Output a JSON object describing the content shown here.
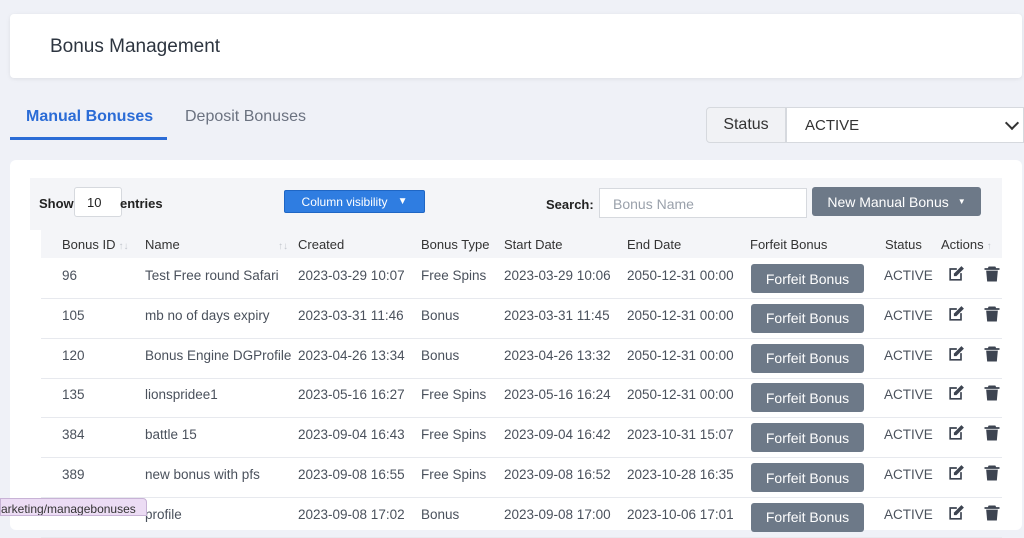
{
  "page": {
    "title": "Bonus Management"
  },
  "tabs": [
    {
      "label": "Manual Bonuses",
      "active": true
    },
    {
      "label": "Deposit Bonuses",
      "active": false
    }
  ],
  "status_filter": {
    "label": "Status",
    "value": "ACTIVE"
  },
  "table_controls": {
    "show_label": "Show",
    "page_length": "10",
    "entries_label": "entries",
    "column_visibility": "Column visibility",
    "search_label": "Search:",
    "search_placeholder": "Bonus Name",
    "new_button": "New Manual Bonus"
  },
  "columns": [
    "Bonus ID",
    "Name",
    "Created",
    "Bonus Type",
    "Start Date",
    "End Date",
    "Forfeit Bonus",
    "Status",
    "Actions"
  ],
  "rows": [
    {
      "id": "96",
      "name": "Test Free round Safari",
      "created": "2023-03-29 10:07",
      "type": "Free Spins",
      "start": "2023-03-29 10:06",
      "end": "2050-12-31 00:00",
      "forfeit": "Forfeit Bonus",
      "status": "ACTIVE"
    },
    {
      "id": "105",
      "name": "mb no of days expiry",
      "created": "2023-03-31 11:46",
      "type": "Bonus",
      "start": "2023-03-31 11:45",
      "end": "2050-12-31 00:00",
      "forfeit": "Forfeit Bonus",
      "status": "ACTIVE"
    },
    {
      "id": "120",
      "name": "Bonus Engine DGProfile",
      "created": "2023-04-26 13:34",
      "type": "Bonus",
      "start": "2023-04-26 13:32",
      "end": "2050-12-31 00:00",
      "forfeit": "Forfeit Bonus",
      "status": "ACTIVE"
    },
    {
      "id": "135",
      "name": "lionspridee1",
      "created": "2023-05-16 16:27",
      "type": "Free Spins",
      "start": "2023-05-16 16:24",
      "end": "2050-12-31 00:00",
      "forfeit": "Forfeit Bonus",
      "status": "ACTIVE"
    },
    {
      "id": "384",
      "name": "battle 15",
      "created": "2023-09-04 16:43",
      "type": "Free Spins",
      "start": "2023-09-04 16:42",
      "end": "2023-10-31 15:07",
      "forfeit": "Forfeit Bonus",
      "status": "ACTIVE"
    },
    {
      "id": "389",
      "name": "new bonus with pfs",
      "created": "2023-09-08 16:55",
      "type": "Free Spins",
      "start": "2023-09-08 16:52",
      "end": "2023-10-28 16:35",
      "forfeit": "Forfeit Bonus",
      "status": "ACTIVE"
    },
    {
      "id": "",
      "name": "profile",
      "created": "2023-09-08 17:02",
      "type": "Bonus",
      "start": "2023-09-08 17:00",
      "end": "2023-10-06 17:01",
      "forfeit": "Forfeit Bonus",
      "status": "ACTIVE"
    }
  ],
  "status_bar": {
    "url": "arketing/managebonuses"
  }
}
